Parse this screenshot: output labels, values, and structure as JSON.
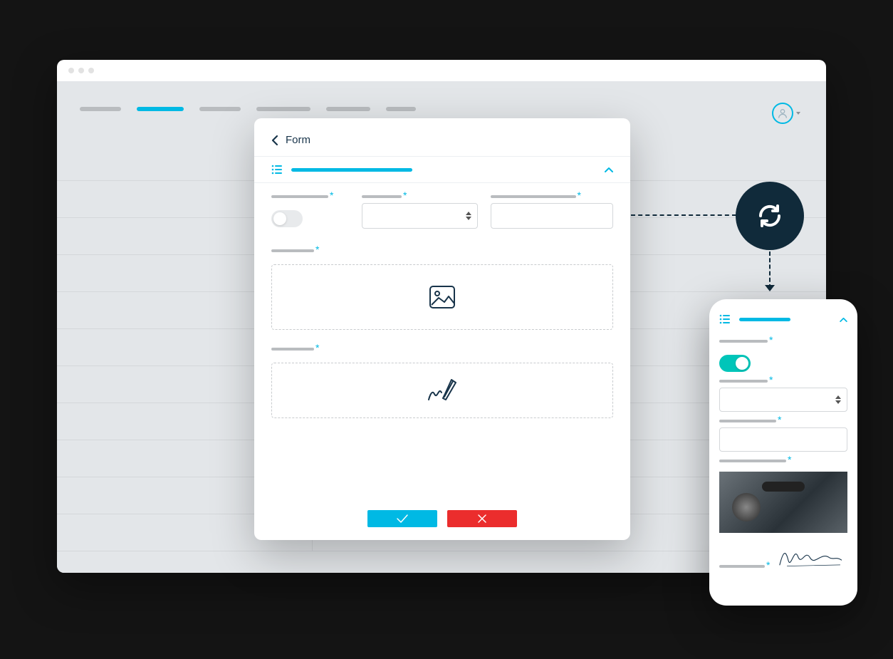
{
  "modal": {
    "title": "Form",
    "asterisk": "*"
  },
  "colors": {
    "accent": "#00b9e4",
    "accent_alt": "#00c5b9",
    "danger": "#eb2d2d",
    "dark": "#102a3a"
  }
}
